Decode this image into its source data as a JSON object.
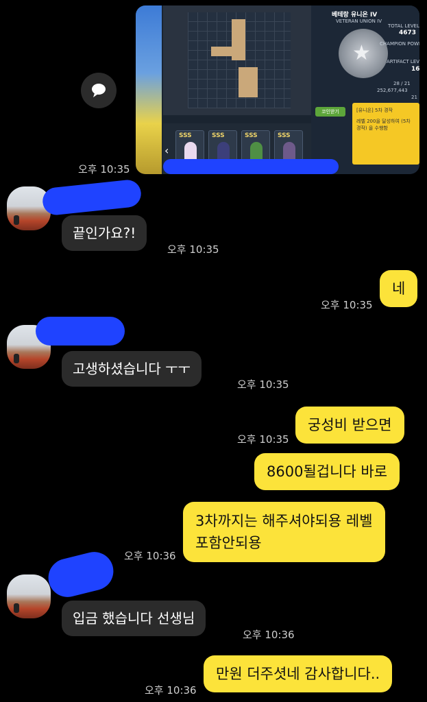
{
  "chat": {
    "share_icon": "chat-bubble-icon",
    "screenshot": {
      "title": "베테랑 유니온 IV",
      "subtitle": "VETERAN UNION IV",
      "total_level_label": "TOTAL LEVEL",
      "total_level_value": "4673",
      "champion_power_label": "CHAMPION POWER",
      "artifact_level_label": "ARTIFACT LEVEL",
      "artifact_level_value": "16",
      "stat1_value": "28 / 21",
      "stat2_value": "252,677,443",
      "stat3_value": "21",
      "button_label": "코인받기",
      "popup_title": "[유니온] 5차 경작",
      "popup_text": "레벨 200을 달성하여 (5차 경작) 을 수행함",
      "card_label": "SSS"
    },
    "messages": [
      {
        "dir": "out",
        "time": "오후 10:35"
      },
      {
        "dir": "in",
        "text": "끝인가요?!",
        "time": "오후 10:35"
      },
      {
        "dir": "out",
        "text": "네",
        "time": "오후 10:35"
      },
      {
        "dir": "in",
        "text": "고생하셨습니다 ㅜㅜ",
        "time": "오후 10:35"
      },
      {
        "dir": "out",
        "text": "궁성비 받으면",
        "time": "오후 10:35"
      },
      {
        "dir": "out",
        "text": "8600될겁니다 바로"
      },
      {
        "dir": "out",
        "line1": "3차까지는 해주셔야되용 레벨",
        "line2": "포함안되용",
        "time": "오후 10:36"
      },
      {
        "dir": "in",
        "text": "입금 했습니다 선생님",
        "time": "오후 10:36"
      },
      {
        "dir": "out",
        "text": "만원 더주셧네 감사합니다..",
        "time": "오후 10:36"
      }
    ]
  }
}
